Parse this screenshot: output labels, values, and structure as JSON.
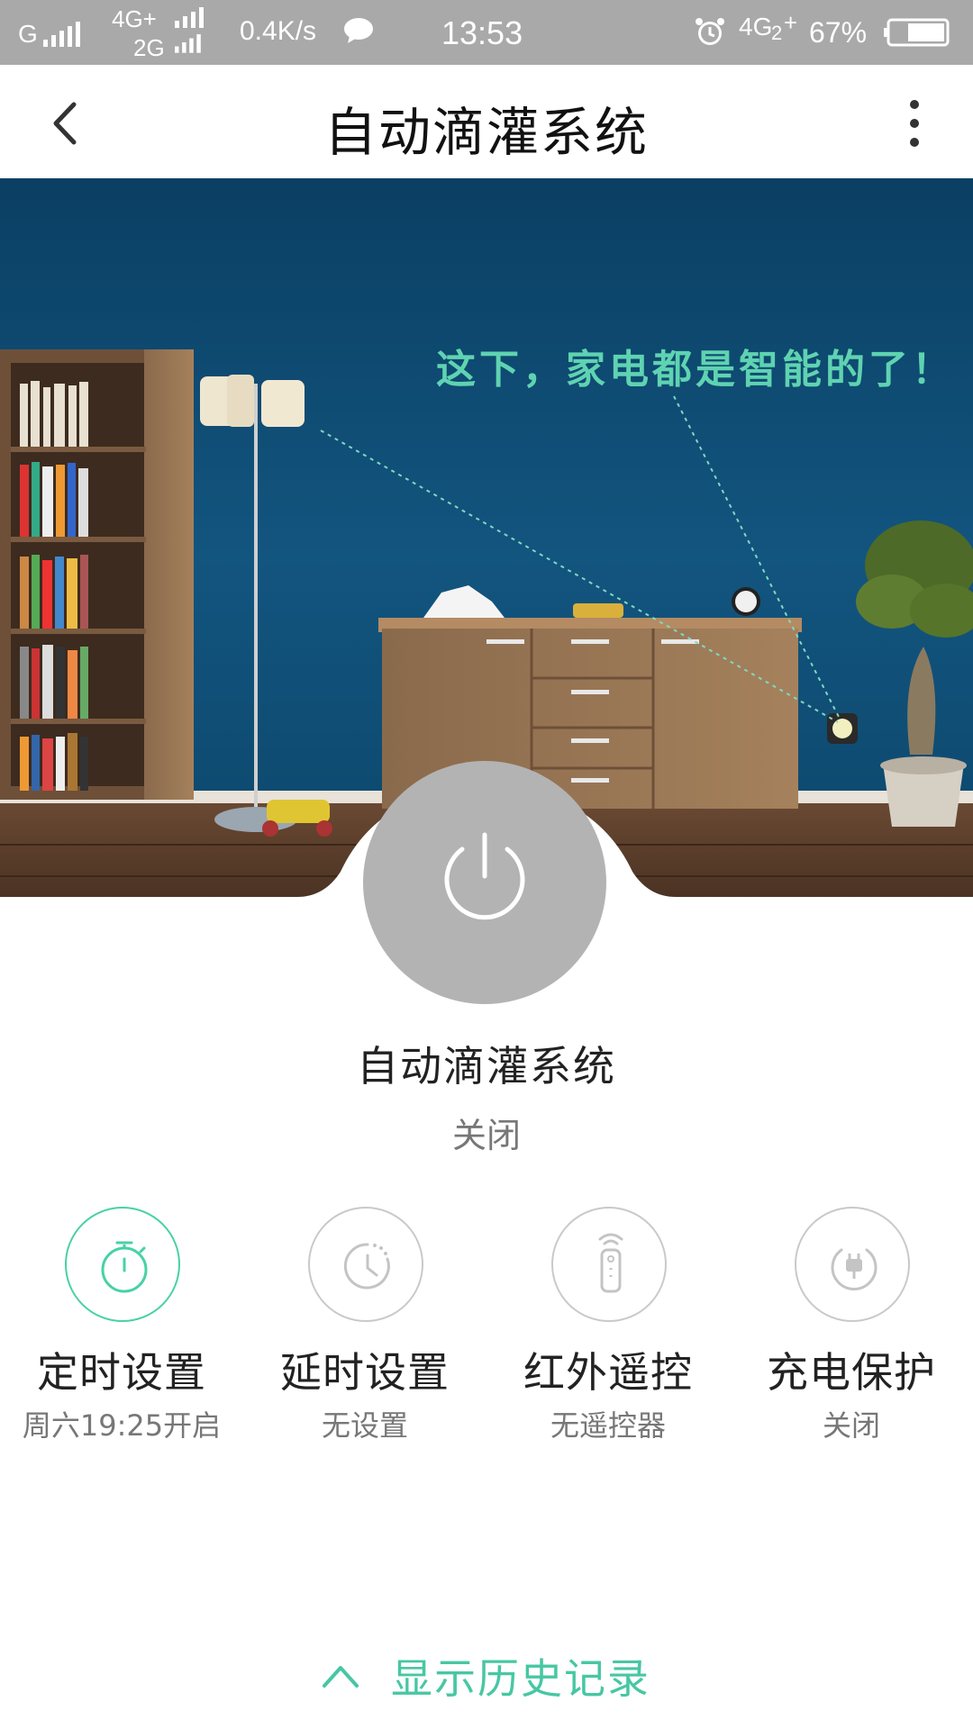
{
  "status_bar": {
    "carrier1": "G",
    "carrier2_top": "4G+",
    "carrier2_bottom": "2G",
    "speed": "0.4K/s",
    "time": "13:53",
    "network": "4G",
    "network_sub": "2",
    "battery": "67%"
  },
  "header": {
    "title": "自动滴灌系统"
  },
  "hero": {
    "slogan": "这下，家电都是智能的了！"
  },
  "device": {
    "name": "自动滴灌系统",
    "state": "关闭"
  },
  "features": [
    {
      "label": "定时设置",
      "sub": "周六19:25开启",
      "icon": "stopwatch-icon",
      "active": true
    },
    {
      "label": "延时设置",
      "sub": "无设置",
      "icon": "clock-icon",
      "active": false
    },
    {
      "label": "红外遥控",
      "sub": "无遥控器",
      "icon": "remote-icon",
      "active": false
    },
    {
      "label": "充电保护",
      "sub": "关闭",
      "icon": "plug-icon",
      "active": false
    }
  ],
  "history": {
    "label": "显示历史记录"
  },
  "colors": {
    "accent": "#47d1a6",
    "status_bar": "#a9a9a9",
    "power_button": "#b3b3b3",
    "wall": "#0f4f78"
  }
}
